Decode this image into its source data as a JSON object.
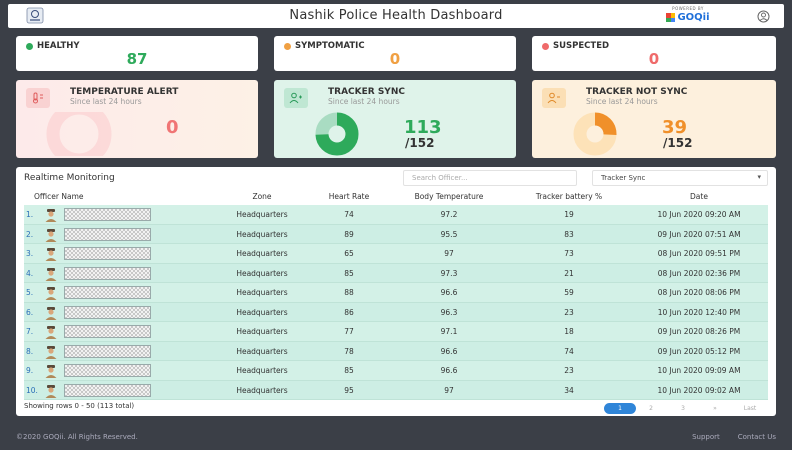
{
  "header": {
    "title": "Nashik Police Health Dashboard",
    "powered_by": "POWERED BY",
    "brand": "GOQii"
  },
  "stats": [
    {
      "label": "HEALTHY",
      "value": "87",
      "color": "#2eaa5b"
    },
    {
      "label": "SYMPTOMATIC",
      "value": "0",
      "color": "#f0a043"
    },
    {
      "label": "SUSPECTED",
      "value": "0",
      "color": "#ef6a6a"
    }
  ],
  "alerts": {
    "temperature": {
      "title": "TEMPERATURE ALERT",
      "subtitle": "Since last 24 hours",
      "value": "0",
      "accent": "#f07575",
      "fraction": 0
    },
    "sync": {
      "title": "TRACKER SYNC",
      "subtitle": "Since last 24 hours",
      "value": "113",
      "total": "/152",
      "accent": "#2eaa5b",
      "fraction": 0.743
    },
    "not_sync": {
      "title": "TRACKER NOT SYNC",
      "subtitle": "Since last 24 hours",
      "value": "39",
      "total": "/152",
      "accent": "#f0902a",
      "fraction": 0.257
    }
  },
  "monitoring": {
    "title": "Realtime Monitoring",
    "search_placeholder": "Search Officer...",
    "filter_value": "Tracker Sync",
    "columns": [
      "Officer Name",
      "Zone",
      "Heart Rate",
      "Body Temperature",
      "Tracker battery %",
      "Date"
    ],
    "rows": [
      {
        "num": "1.",
        "zone": "Headquarters",
        "hr": "74",
        "temp": "97.2",
        "battery": "19",
        "date": "10 Jun 2020 09:20 AM"
      },
      {
        "num": "2.",
        "zone": "Headquarters",
        "hr": "89",
        "temp": "95.5",
        "battery": "83",
        "date": "09 Jun 2020 07:51 AM"
      },
      {
        "num": "3.",
        "zone": "Headquarters",
        "hr": "65",
        "temp": "97",
        "battery": "73",
        "date": "08 Jun 2020 09:51 PM"
      },
      {
        "num": "4.",
        "zone": "Headquarters",
        "hr": "85",
        "temp": "97.3",
        "battery": "21",
        "date": "08 Jun 2020 02:36 PM"
      },
      {
        "num": "5.",
        "zone": "Headquarters",
        "hr": "88",
        "temp": "96.6",
        "battery": "59",
        "date": "08 Jun 2020 08:06 PM"
      },
      {
        "num": "6.",
        "zone": "Headquarters",
        "hr": "86",
        "temp": "96.3",
        "battery": "23",
        "date": "10 Jun 2020 12:40 PM"
      },
      {
        "num": "7.",
        "zone": "Headquarters",
        "hr": "77",
        "temp": "97.1",
        "battery": "18",
        "date": "09 Jun 2020 08:26 PM"
      },
      {
        "num": "8.",
        "zone": "Headquarters",
        "hr": "78",
        "temp": "96.6",
        "battery": "74",
        "date": "09 Jun 2020 05:12 PM"
      },
      {
        "num": "9.",
        "zone": "Headquarters",
        "hr": "85",
        "temp": "96.6",
        "battery": "23",
        "date": "10 Jun 2020 09:09 AM"
      },
      {
        "num": "10.",
        "zone": "Headquarters",
        "hr": "95",
        "temp": "97",
        "battery": "34",
        "date": "10 Jun 2020 09:02 AM"
      }
    ],
    "showing": "Showing rows 0 - 50 (113 total)",
    "pager": {
      "current": "1",
      "pages": [
        "2",
        "3",
        "»"
      ],
      "last": "Last"
    }
  },
  "footer": {
    "copyright": "©2020 GOQii. All Rights Reserved.",
    "links": [
      "Support",
      "Contact Us"
    ]
  }
}
